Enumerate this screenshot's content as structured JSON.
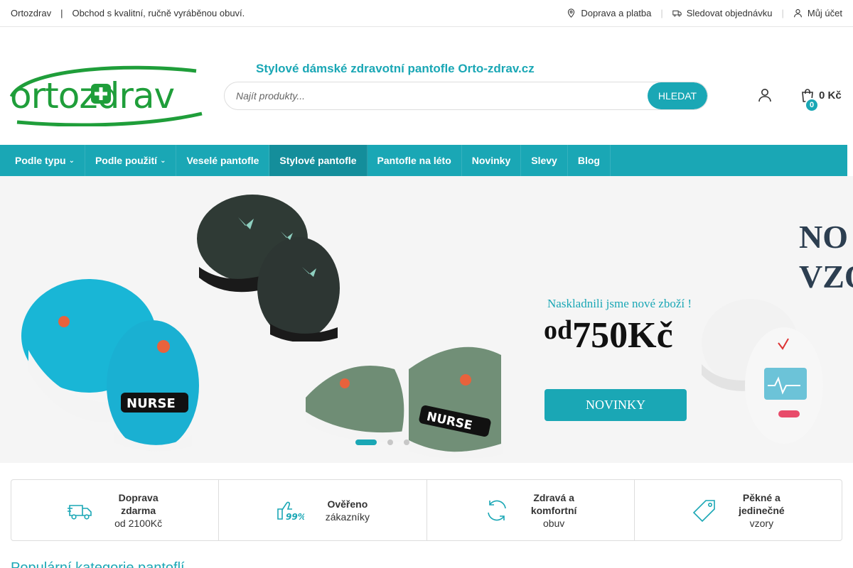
{
  "topbar": {
    "brand": "Ortozdrav",
    "slogan": "Obchod s kvalitní, ručně vyráběnou obuví.",
    "links": [
      {
        "label": "Doprava a platba",
        "icon": "location-pin-icon"
      },
      {
        "label": "Sledovat objednávku",
        "icon": "truck-icon"
      },
      {
        "label": "Můj účet",
        "icon": "user-icon"
      }
    ]
  },
  "header": {
    "logo_text": "ortozdrav",
    "tagline": "Stylové dámské zdravotní pantofle Orto-zdrav.cz",
    "search_placeholder": "Najít produkty...",
    "search_button": "HLEDAT",
    "cart_count": "0",
    "cart_amount": "0 Kč"
  },
  "nav": {
    "items": [
      {
        "label": "Podle typu",
        "dropdown": true
      },
      {
        "label": "Podle použití",
        "dropdown": true
      },
      {
        "label": "Veselé pantofle"
      },
      {
        "label": "Stylové pantofle",
        "active": true
      },
      {
        "label": "Pantofle na léto"
      },
      {
        "label": "Novinky"
      },
      {
        "label": "Slevy"
      },
      {
        "label": "Blog"
      }
    ]
  },
  "hero": {
    "subtitle": "Naskladnili jsme nové zboží !",
    "price_prefix": "od",
    "price_value": "750Kč",
    "cta": "NOVINKY",
    "headline_line1": "NO",
    "headline_line2": "VZO",
    "slides": 3,
    "active_slide": 1
  },
  "features": [
    {
      "line1": "Doprava",
      "line2": "zdarma",
      "line3": "od 2100Kč",
      "icon": "delivery-truck-icon"
    },
    {
      "line1": "Ověřeno",
      "line2": "zákazníky",
      "line3": "",
      "icon": "thumbs-up-99-icon"
    },
    {
      "line1": "Zdravá a",
      "line2": "komfortní",
      "line3": "obuv",
      "icon": "refresh-icon"
    },
    {
      "line1": "Pěkné a",
      "line2": "jedinečné",
      "line3": "vzory",
      "icon": "tag-icon"
    }
  ],
  "section_title": "Populární kategorie pantoflí",
  "colors": {
    "accent": "#1aa7b5",
    "accent_dark": "#148e9b",
    "logo_green": "#1f9e3a",
    "heading_dark": "#2c3e50"
  }
}
